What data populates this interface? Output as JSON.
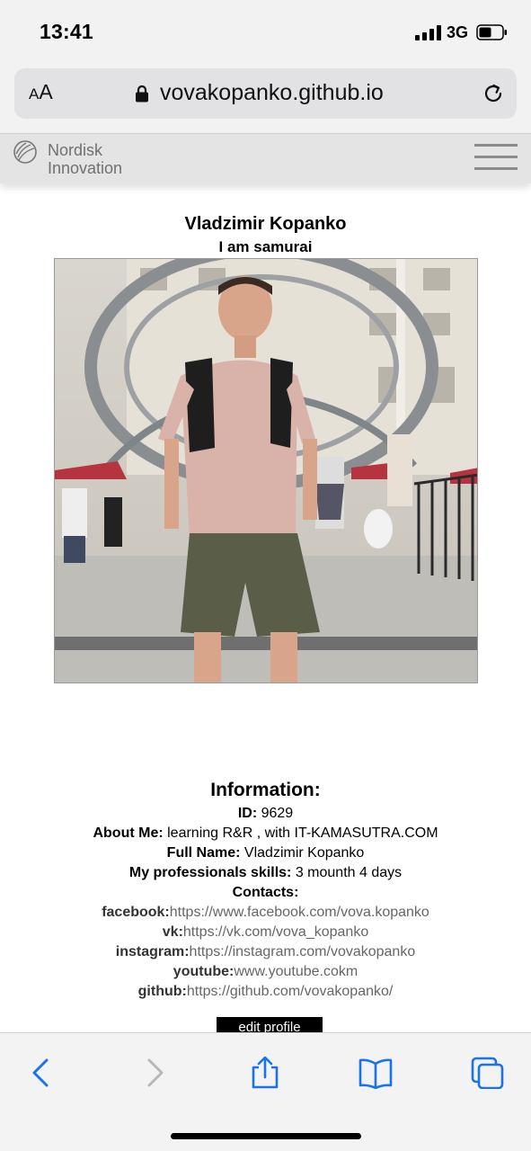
{
  "status_bar": {
    "time": "13:41",
    "network": "3G"
  },
  "browser": {
    "aa_small": "A",
    "aa_large": "A",
    "url": "vovakopanko.github.io"
  },
  "site": {
    "logo_line1": "Nordisk",
    "logo_line2": "Innovation"
  },
  "profile": {
    "name": "Vladzimir Kopanko",
    "status": "I am samurai",
    "avatar": "photo of a young man in a pink t-shirt and olive shorts"
  },
  "information": {
    "title": "Information:",
    "id_label": "ID:",
    "id_value": "9629",
    "about_label": "About Me:",
    "about_value": "learning R&R , with IT-KAMASUTRA.COM",
    "fullname_label": "Full Name:",
    "fullname_value": "Vladzimir Kopanko",
    "skills_label": "My professionals skills:",
    "skills_value": "3 mounth 4 days",
    "contacts_label": "Contacts:"
  },
  "contacts": [
    {
      "label": "facebook:",
      "value": "https://www.facebook.com/vova.kopanko"
    },
    {
      "label": "vk:",
      "value": "https://vk.com/vova_kopanko"
    },
    {
      "label": "instagram:",
      "value": "https://instagram.com/vovakopanko"
    },
    {
      "label": "youtube:",
      "value": "www.youtube.cokm"
    },
    {
      "label": "github:",
      "value": "https://github.com/vovakopanko/"
    }
  ],
  "edit_button": "edit profile",
  "toolbar": {
    "icons": [
      "back-icon",
      "forward-icon",
      "share-icon",
      "bookmarks-icon",
      "tabs-icon"
    ]
  },
  "colors": {
    "toolbar_active": "#1a73e8",
    "toolbar_disabled": "#b8b8b8"
  }
}
